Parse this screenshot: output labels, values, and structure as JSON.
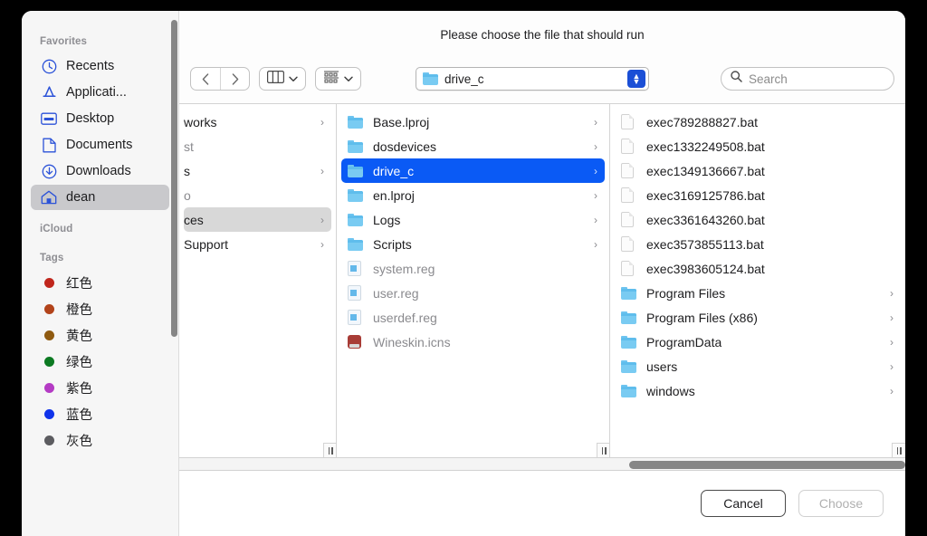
{
  "dialog": {
    "title": "Please choose the file that should run"
  },
  "sidebar": {
    "favorites_label": "Favorites",
    "favorites": [
      {
        "label": "Recents",
        "icon": "clock-icon"
      },
      {
        "label": "Applicati...",
        "icon": "appstore-icon"
      },
      {
        "label": "Desktop",
        "icon": "desktop-icon"
      },
      {
        "label": "Documents",
        "icon": "document-icon"
      },
      {
        "label": "Downloads",
        "icon": "download-icon"
      },
      {
        "label": "dean",
        "icon": "home-icon"
      }
    ],
    "icloud_label": "iCloud",
    "tags_label": "Tags",
    "tags": [
      {
        "label": "红色",
        "color": "#c0261c"
      },
      {
        "label": "橙色",
        "color": "#b2431a"
      },
      {
        "label": "黄色",
        "color": "#8f5a10"
      },
      {
        "label": "绿色",
        "color": "#0c7a22"
      },
      {
        "label": "紫色",
        "color": "#b43bc4"
      },
      {
        "label": "蓝色",
        "color": "#1033ea"
      },
      {
        "label": "灰色",
        "color": "#5c5c60"
      }
    ]
  },
  "toolbar": {
    "back_icon": "chevron-left-icon",
    "forward_icon": "chevron-right-icon",
    "view_icon": "column-view-icon",
    "view_chevron": "chevron-down-icon",
    "group_icon": "group-by-icon",
    "group_chevron": "chevron-down-icon",
    "path_value": "drive_c",
    "path_icon": "folder-icon",
    "stepper_up": "▲",
    "stepper_down": "▼",
    "search_icon": "search-icon",
    "search_placeholder": "Search",
    "search_value": ""
  },
  "columns": {
    "column1": [
      {
        "label": "works",
        "type": "folder",
        "chevron": true,
        "state": "normal"
      },
      {
        "label": "st",
        "type": "none",
        "chevron": false,
        "state": "gray"
      },
      {
        "label": "s",
        "type": "none",
        "chevron": true,
        "state": "normal"
      },
      {
        "label": "o",
        "type": "none",
        "chevron": false,
        "state": "gray"
      },
      {
        "label": "ces",
        "type": "none",
        "chevron": true,
        "state": "highlight"
      },
      {
        "label": "Support",
        "type": "none",
        "chevron": true,
        "state": "normal"
      }
    ],
    "column2": [
      {
        "label": "Base.lproj",
        "type": "folder",
        "chevron": true,
        "state": "normal"
      },
      {
        "label": "dosdevices",
        "type": "folder",
        "chevron": true,
        "state": "normal"
      },
      {
        "label": "drive_c",
        "type": "folder",
        "chevron": true,
        "state": "selected"
      },
      {
        "label": "en.lproj",
        "type": "folder",
        "chevron": true,
        "state": "normal"
      },
      {
        "label": "Logs",
        "type": "folder",
        "chevron": true,
        "state": "normal"
      },
      {
        "label": "Scripts",
        "type": "folder",
        "chevron": true,
        "state": "normal"
      },
      {
        "label": "system.reg",
        "type": "reg",
        "chevron": false,
        "state": "gray"
      },
      {
        "label": "user.reg",
        "type": "reg",
        "chevron": false,
        "state": "gray"
      },
      {
        "label": "userdef.reg",
        "type": "reg",
        "chevron": false,
        "state": "gray"
      },
      {
        "label": "Wineskin.icns",
        "type": "icns",
        "chevron": false,
        "state": "gray"
      }
    ],
    "column3": [
      {
        "label": "exec789288827.bat",
        "type": "doc",
        "chevron": false,
        "state": "normal"
      },
      {
        "label": "exec1332249508.bat",
        "type": "doc",
        "chevron": false,
        "state": "normal"
      },
      {
        "label": "exec1349136667.bat",
        "type": "doc",
        "chevron": false,
        "state": "normal"
      },
      {
        "label": "exec3169125786.bat",
        "type": "doc",
        "chevron": false,
        "state": "normal"
      },
      {
        "label": "exec3361643260.bat",
        "type": "doc",
        "chevron": false,
        "state": "normal"
      },
      {
        "label": "exec3573855113.bat",
        "type": "doc",
        "chevron": false,
        "state": "normal"
      },
      {
        "label": "exec3983605124.bat",
        "type": "doc",
        "chevron": false,
        "state": "normal"
      },
      {
        "label": "Program Files",
        "type": "folder",
        "chevron": true,
        "state": "normal"
      },
      {
        "label": "Program Files (x86)",
        "type": "folder",
        "chevron": true,
        "state": "normal"
      },
      {
        "label": "ProgramData",
        "type": "folder",
        "chevron": true,
        "state": "normal"
      },
      {
        "label": "users",
        "type": "folder",
        "chevron": true,
        "state": "normal"
      },
      {
        "label": "windows",
        "type": "folder",
        "chevron": true,
        "state": "normal"
      }
    ]
  },
  "footer": {
    "cancel_label": "Cancel",
    "choose_label": "Choose"
  },
  "colors": {
    "selection_blue": "#0a5af5",
    "stepper_blue": "#1b4fd6",
    "sidebar_icon_blue": "#2b52d8"
  }
}
